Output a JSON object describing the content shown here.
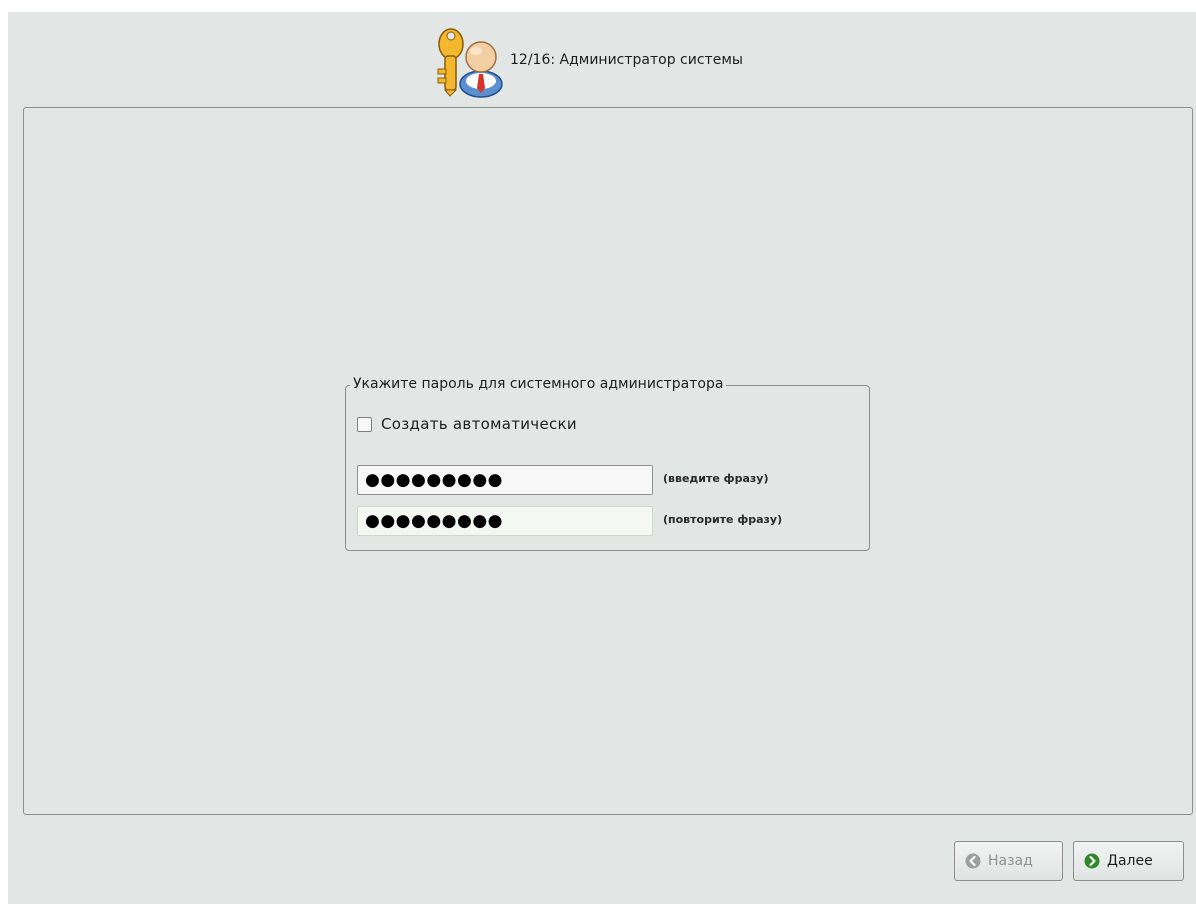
{
  "header": {
    "step_title": "12/16: Администратор системы",
    "icon": "key-user-icon"
  },
  "password_group": {
    "legend": "Укажите пароль для системного администратора",
    "auto_generate": {
      "label": "Создать автоматически",
      "checked": false
    },
    "password_field": {
      "value": "●●●●●●●●●",
      "hint": "(введите фразу)"
    },
    "confirm_field": {
      "value": "●●●●●●●●●",
      "hint": "(повторите фразу)"
    }
  },
  "buttons": {
    "back": {
      "label": "Назад",
      "icon": "arrow-left-icon",
      "enabled": false
    },
    "next": {
      "label": "Далее",
      "icon": "arrow-right-icon",
      "enabled": true
    }
  },
  "colors": {
    "background": "#e2e7e5",
    "border": "#8c8f8d",
    "next_icon": "#2f8a2c",
    "disabled_icon": "#9aa19d"
  }
}
